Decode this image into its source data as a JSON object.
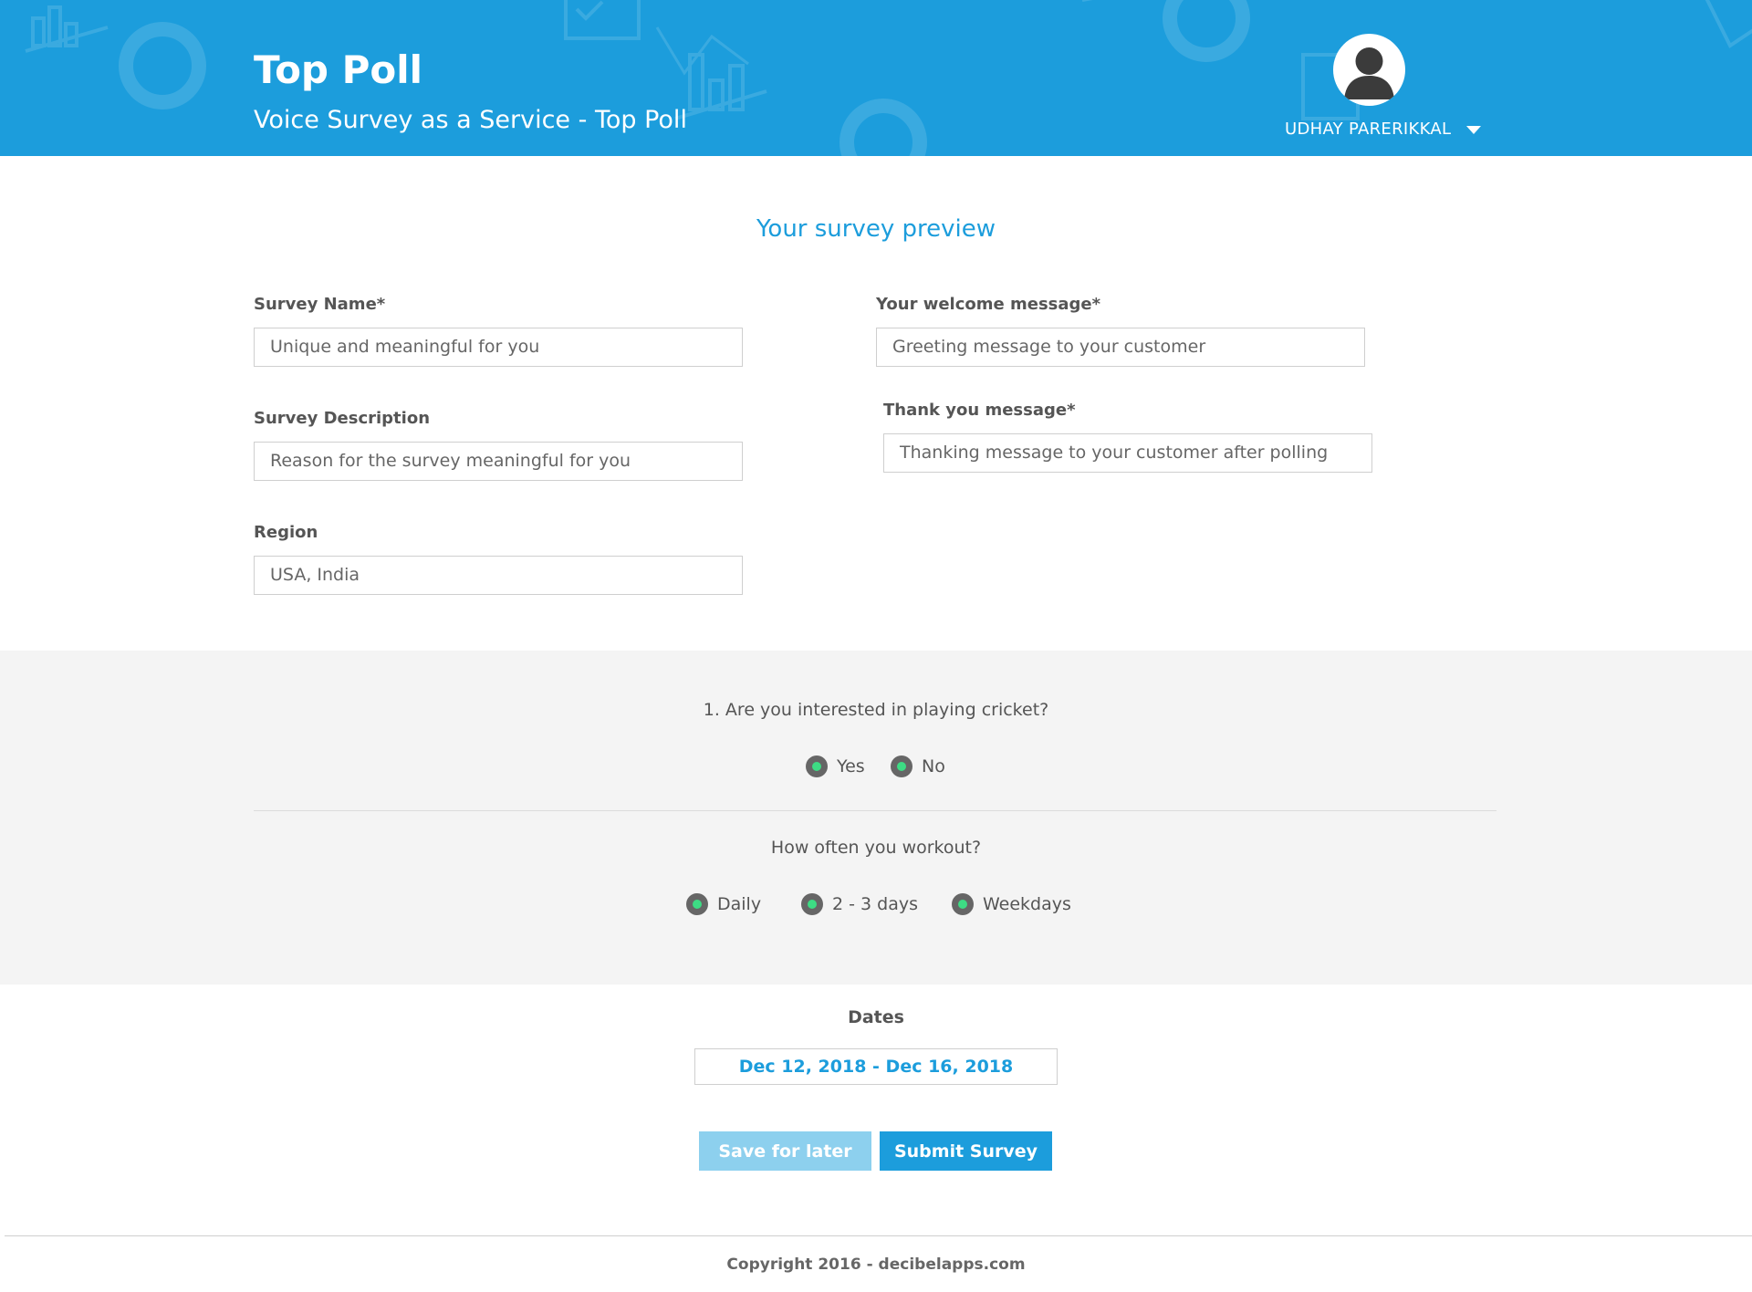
{
  "header": {
    "title": "Top Poll",
    "subtitle": "Voice Survey as a Service - Top Poll",
    "user": {
      "name": "UDHAY PARERIKKAL",
      "avatar_icon": "user-avatar-icon",
      "menu_icon": "caret-down-icon"
    }
  },
  "preview": {
    "heading": "Your survey preview",
    "left_fields": [
      {
        "label": "Survey  Name*",
        "value": "Unique and meaningful for you"
      },
      {
        "label": "Survey Description",
        "value": "Reason for the survey meaningful for you"
      },
      {
        "label": "Region",
        "value": "USA, India"
      }
    ],
    "right_fields": [
      {
        "label": "Your welcome message*",
        "value": "Greeting message to your customer"
      },
      {
        "label": "Thank you message*",
        "value": "Thanking message to your customer after polling"
      }
    ]
  },
  "questions": [
    {
      "text": "1. Are you interested in playing cricket?",
      "options": [
        "Yes",
        "No"
      ]
    },
    {
      "text": "How often you workout?",
      "options": [
        "Daily",
        "2 - 3 days",
        "Weekdays"
      ]
    }
  ],
  "dates": {
    "label": "Dates",
    "value": "Dec 12, 2018 - Dec 16, 2018"
  },
  "buttons": {
    "save_label": "Save for later",
    "submit_label": "Submit Survey"
  },
  "footer": {
    "copyright": "Copyright 2016 - decibelapps.com"
  },
  "colors": {
    "brand": "#1c9ddc",
    "save_button": "#8dd0ee",
    "radio_dot": "#3ddc84",
    "questions_bg": "#f4f4f4"
  }
}
